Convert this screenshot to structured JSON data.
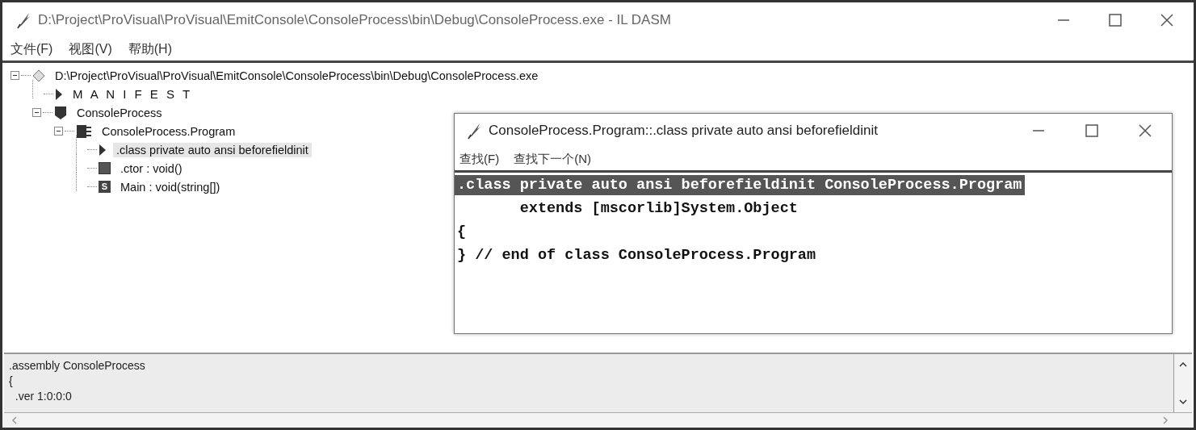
{
  "window": {
    "title": "D:\\Project\\ProVisual\\ProVisual\\EmitConsole\\ConsoleProcess\\bin\\Debug\\ConsoleProcess.exe - IL DASM"
  },
  "menu": [
    "文件(F)",
    "视图(V)",
    "帮助(H)"
  ],
  "tree": [
    {
      "kind": "assembly",
      "label": "D:\\Project\\ProVisual\\ProVisual\\EmitConsole\\ConsoleProcess\\bin\\Debug\\ConsoleProcess.exe",
      "expanded": true,
      "selected": false,
      "children": [
        {
          "kind": "manifest",
          "label": "M A N I F E S T",
          "selected": false
        },
        {
          "kind": "namespace",
          "label": "ConsoleProcess",
          "expanded": true,
          "selected": false,
          "children": [
            {
              "kind": "class",
              "label": "ConsoleProcess.Program",
              "expanded": true,
              "selected": false,
              "children": [
                {
                  "kind": "classinfo",
                  "label": ".class private auto ansi beforefieldinit",
                  "selected": true
                },
                {
                  "kind": "method",
                  "label": ".ctor : void()",
                  "selected": false
                },
                {
                  "kind": "static",
                  "badge": "S",
                  "label": "Main : void(string[])",
                  "selected": false
                }
              ]
            }
          ]
        }
      ]
    }
  ],
  "detail_pane": {
    "lines": [
      ".assembly ConsoleProcess",
      "{",
      "  .ver 1:0:0:0"
    ]
  },
  "child_window": {
    "title": "ConsoleProcess.Program::.class private auto ansi beforefieldinit",
    "menu": [
      "查找(F)",
      "查找下一个(N)"
    ],
    "code_lines": [
      {
        "text": ".class private auto ansi beforefieldinit ConsoleProcess.Program",
        "selected": true
      },
      {
        "text": "       extends [mscorlib]System.Object",
        "selected": false
      },
      {
        "text": "{",
        "selected": false
      },
      {
        "text": "} // end of class ConsoleProcess.Program",
        "selected": false
      }
    ]
  }
}
